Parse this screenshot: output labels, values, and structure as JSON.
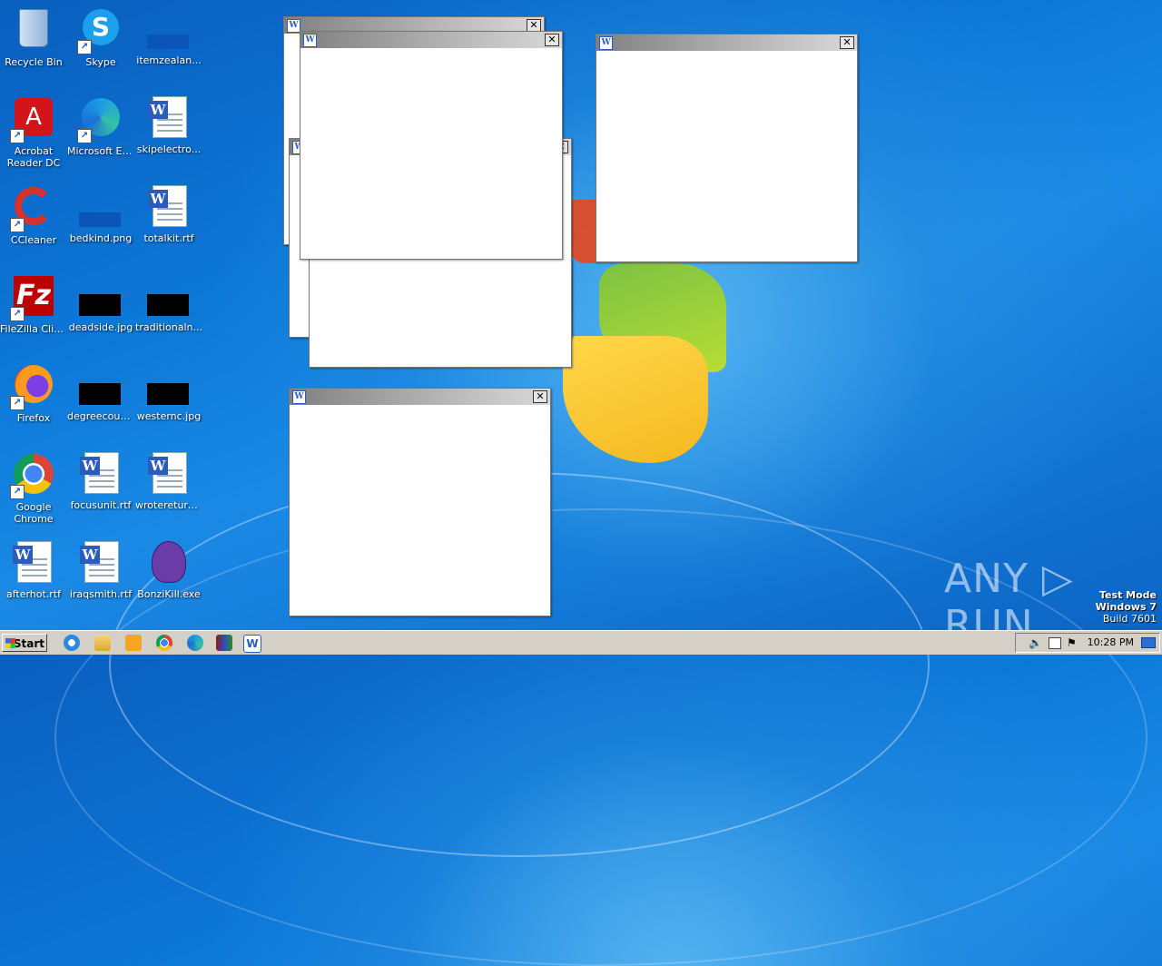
{
  "desktop": {
    "icons": [
      {
        "label": "Recycle Bin",
        "icon": "recycle-bin-icon"
      },
      {
        "label": "Skype",
        "icon": "skype-icon"
      },
      {
        "label": "itemzealan...",
        "icon": "image-file-icon"
      },
      {
        "label": "Acrobat\nReader DC",
        "icon": "acrobat-icon"
      },
      {
        "label": "Microsoft Edge",
        "icon": "edge-icon"
      },
      {
        "label": "skipelectro...",
        "icon": "word-doc-icon"
      },
      {
        "label": "CCleaner",
        "icon": "ccleaner-icon"
      },
      {
        "label": "bedkind.png",
        "icon": "image-file-icon"
      },
      {
        "label": "totalkit.rtf",
        "icon": "word-doc-icon"
      },
      {
        "label": "FileZilla Client",
        "icon": "filezilla-icon"
      },
      {
        "label": "deadside.jpg",
        "icon": "image-file-icon"
      },
      {
        "label": "traditionaln...",
        "icon": "image-file-icon"
      },
      {
        "label": "Firefox",
        "icon": "firefox-icon"
      },
      {
        "label": "degreecoun...",
        "icon": "image-file-icon"
      },
      {
        "label": "westernc.jpg",
        "icon": "image-file-icon"
      },
      {
        "label": "Google\nChrome",
        "icon": "chrome-icon"
      },
      {
        "label": "focusunit.rtf",
        "icon": "word-doc-icon"
      },
      {
        "label": "wrotereturn...",
        "icon": "word-doc-icon"
      },
      {
        "label": "afterhot.rtf",
        "icon": "word-doc-icon"
      },
      {
        "label": "iraqsmith.rtf",
        "icon": "word-doc-icon"
      },
      {
        "label": "BonziKill.exe",
        "icon": "bonzi-icon"
      }
    ]
  },
  "windows": {
    "close_glyph": "✕",
    "app_glyph": "W"
  },
  "taskbar": {
    "start_label": "Start",
    "clock": "10:28 PM"
  },
  "watermark": {
    "text": "ANY ▷ RUN"
  },
  "test_mode": {
    "line1": "Test Mode",
    "line2": "Windows 7",
    "line3": "Build 7601"
  }
}
